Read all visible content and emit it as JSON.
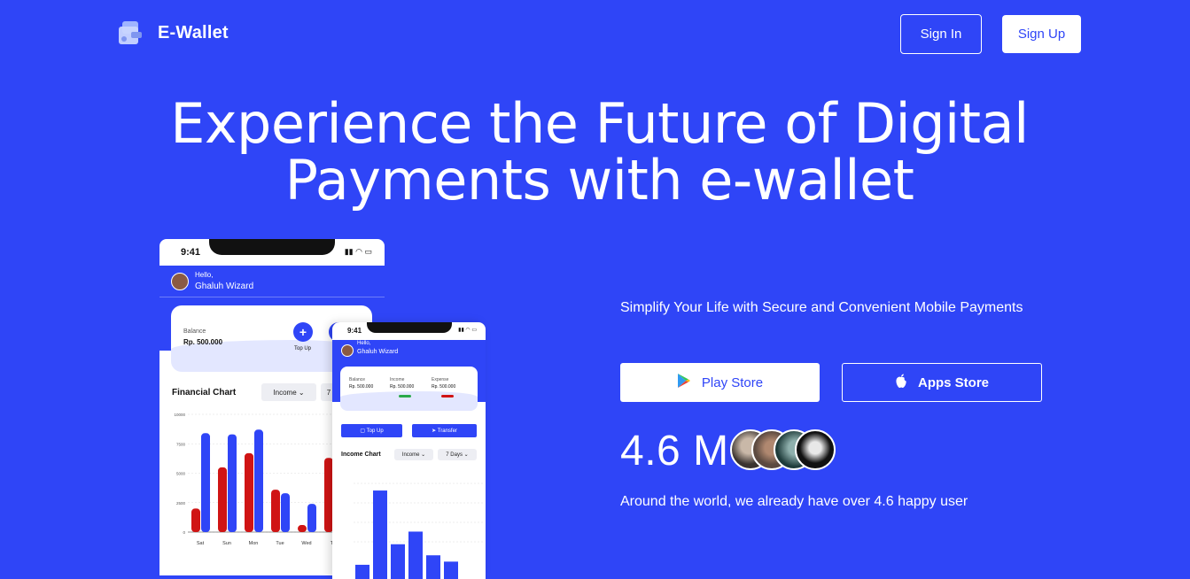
{
  "nav": {
    "brand": "E-Wallet",
    "signin": "Sign In",
    "signup": "Sign Up"
  },
  "hero": {
    "title_line1": "Experience the Future of Digital",
    "title_line2": "Payments with e-wallet"
  },
  "panel": {
    "tagline": "Simplify Your Life with Secure and Convenient Mobile Payments",
    "play_store": "Play Store",
    "apps_store": "Apps Store",
    "stat_value": "4.6 M",
    "stat_text": "Around the world, we already have over 4.6 happy user"
  },
  "colors": {
    "brand": "#2F45F7",
    "income_bar": "#2F45F7",
    "expense_bar": "#D01414"
  },
  "phone_big": {
    "time": "9:41",
    "greeting": "Hello,",
    "user": "Ghaluh Wizard",
    "balance_label": "Balance",
    "balance_value": "Rp. 500.000",
    "topup_label": "Top Up",
    "chart_title": "Financial Chart",
    "chart_filter": "Income",
    "chart_period": "7"
  },
  "phone_small": {
    "time": "9:41",
    "greeting": "Hello,",
    "user": "Ghaluh Wizard",
    "balance_label": "Balance",
    "balance_value": "Rp. 500.000",
    "income_label": "Income",
    "income_value": "Rp. 500.000",
    "expense_label": "Expense",
    "expense_value": "Rp. 500.000",
    "topup": "Top Up",
    "transfer": "Transfer",
    "chart_title": "Income Chart",
    "chart_filter": "Income",
    "chart_period": "7 Days"
  },
  "chart_data": [
    {
      "type": "bar",
      "categories": [
        "Sat",
        "Sun",
        "Mon",
        "Tue",
        "Wed",
        "Th"
      ],
      "ylim": [
        0,
        10000
      ],
      "yticks": [
        "0",
        "2500",
        "5000",
        "7500",
        "10000"
      ],
      "series": [
        {
          "values": [
            2000,
            5500,
            6700,
            3600,
            600,
            6300
          ]
        },
        {
          "values": [
            8400,
            8300,
            8700,
            3300,
            2400,
            0
          ]
        }
      ]
    },
    {
      "type": "bar",
      "categories": [
        "",
        "",
        "",
        "",
        "",
        "",
        ""
      ],
      "values": [
        900,
        5600,
        2200,
        3000,
        1500,
        1100,
        0
      ],
      "ylim": [
        0,
        6500
      ]
    }
  ]
}
